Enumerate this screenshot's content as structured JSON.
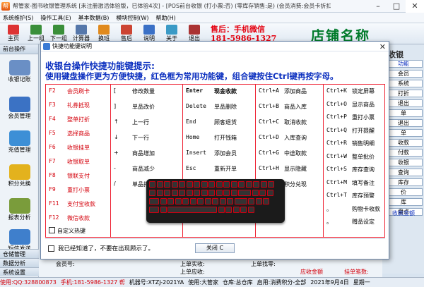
{
  "window": {
    "title": "帮管家-图书收银管理系统 [未注册激活体验版，已体验4次] - [POS前台收银 (打小票:否) (零库存销售:是) (会员消费:会员卡折扣) (开钱箱:无)]"
  },
  "menu": [
    "系统维护(S)",
    "操作工具(E)",
    "基本数据(B)",
    "模块控制(W)",
    "帮助(H)"
  ],
  "toolbar": [
    "主页",
    "上一组",
    "下一组",
    "计算器",
    "换班",
    "售后",
    "说明",
    "关于",
    "退出"
  ],
  "brand": {
    "phone_label": "售后：手机微信",
    "phone": "181-5986-1327",
    "shop_name": "店铺名称"
  },
  "sidebar": {
    "header": "前台操作",
    "items": [
      "收银记账",
      "会员管理",
      "充值管理",
      "积分兑换",
      "报表分析",
      "短信发送"
    ],
    "bottom": [
      "仓储管理",
      "数据分析",
      "系统设置"
    ]
  },
  "right_panel": {
    "header": "收银",
    "items": [
      "功能",
      "会员",
      "系统",
      "打折",
      "退出",
      "单",
      "退出",
      "单",
      "收款",
      "付款",
      "收银",
      "查询",
      "库存",
      "价",
      "库",
      "盘点"
    ],
    "footer": "收款金额"
  },
  "bottom": {
    "member_no": "会员号:",
    "member_points": "上单实收:",
    "last_amount": "上单应收:",
    "last_change": "上单找零:",
    "total": "应收金额",
    "status": "挂单笔数:"
  },
  "statusbar": [
    "使用:QQ:328800873",
    "手机:181-5986-1327 帮",
    "机器号:XTZJ-2021YA",
    "使用:大管家",
    "仓库:总仓库",
    "启用:消费积分-全部",
    "2021年9月4日",
    "星期一"
  ],
  "dialog": {
    "title": "快捷功能键说明",
    "hint1": "收银台操作快捷功能键提示:",
    "hint2": "使用键盘操作更为方便快捷，红色框为常用功能键，组合键按住Ctrl键再按字母。",
    "col1": [
      [
        "F2",
        "会员刷卡"
      ],
      [
        "F3",
        "礼券抵现"
      ],
      [
        "F4",
        "整单打折"
      ],
      [
        "F5",
        "选择商品"
      ],
      [
        "F6",
        "收银挂单"
      ],
      [
        "F7",
        "收银取单"
      ],
      [
        "F8",
        "银联支付"
      ],
      [
        "F9",
        "重打小票"
      ],
      [
        "F11",
        "支付宝收款"
      ],
      [
        "F12",
        "微信收款"
      ]
    ],
    "col2": [
      [
        "[",
        "修改数量"
      ],
      [
        "]",
        "单品改价"
      ],
      [
        "↑",
        "上一行"
      ],
      [
        "↓",
        "下一行"
      ],
      [
        "+",
        "商品增加"
      ],
      [
        "-",
        "商品减少"
      ],
      [
        "/",
        "单品打折"
      ]
    ],
    "col3": [
      [
        "Enter",
        "现金收款"
      ],
      [
        "Delete",
        "单品删除"
      ],
      [
        "End",
        "顾客退货"
      ],
      [
        "Home",
        "打开钱箱"
      ],
      [
        "Insert",
        "添加会员"
      ],
      [
        "Esc",
        "重新开单"
      ],
      [
        "\\",
        "导购设置"
      ]
    ],
    "col4": [
      [
        "Ctrl+A",
        "添加商品"
      ],
      [
        "Ctrl+B",
        "商品入库"
      ],
      [
        "Ctrl+C",
        "取消收款"
      ],
      [
        "Ctrl+D",
        "入库查询"
      ],
      [
        "Ctrl+G",
        "中途取款"
      ],
      [
        "Ctrl+H",
        "显示隐藏"
      ],
      [
        "Ctrl+I",
        "积分兑现"
      ]
    ],
    "col5": [
      [
        "Ctrl+K",
        "锁定屏幕"
      ],
      [
        "Ctrl+O",
        "显示商品"
      ],
      [
        "Ctrl+P",
        "重打小票"
      ],
      [
        "Ctrl+Q",
        "打开提醒"
      ],
      [
        "Ctrl+R",
        "销售明细"
      ],
      [
        "Ctrl+W",
        "整单批价"
      ],
      [
        "Ctrl+S",
        "库存查询"
      ],
      [
        "Ctrl+M",
        "填写备注"
      ],
      [
        "Ctrl+T",
        "库存预警"
      ],
      [
        "。",
        "购物卡收款"
      ],
      [
        "。",
        "赠品设定"
      ]
    ],
    "custom_hotkey": "自定义热键",
    "agree": "我已经知道了，不要在出现顾示了。",
    "close": "关闭 C"
  },
  "colors": {
    "accent_red": "#d4000b",
    "hint_blue": "#0b2fbf",
    "brand_green": "#007a2a"
  }
}
